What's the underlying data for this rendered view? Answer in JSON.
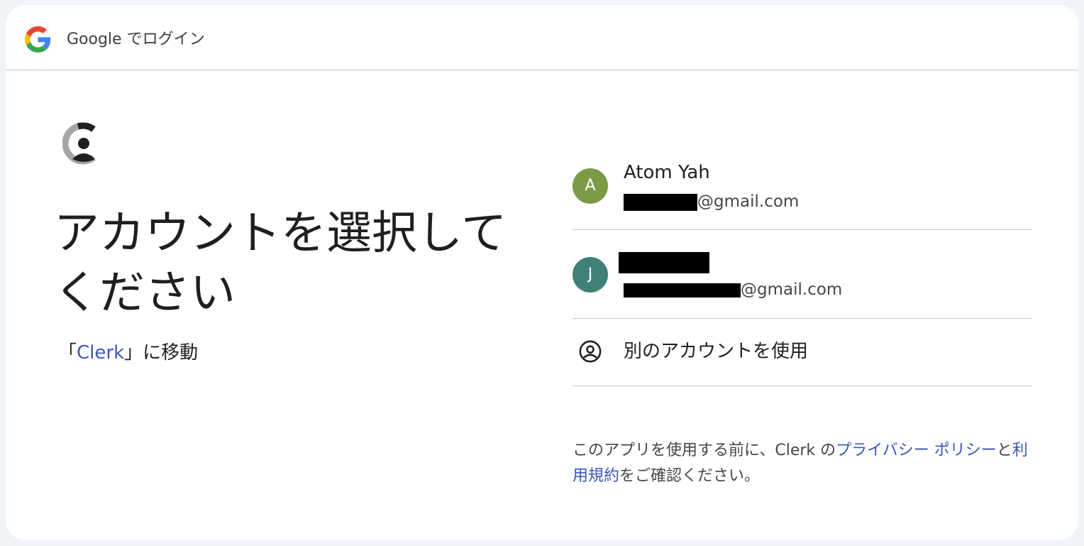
{
  "header": {
    "title": "Google でログイン",
    "logo_icon": "google-g-icon"
  },
  "app": {
    "logo_icon": "clerk-logo-icon"
  },
  "main": {
    "title": "アカウントを選択してください",
    "continue_prefix": "「",
    "continue_app": "Clerk",
    "continue_suffix": "」に移動"
  },
  "accounts": [
    {
      "initial": "A",
      "name": "Atom Yah",
      "email_visible": "@gmail.com",
      "avatar_color": "#7b9b46"
    },
    {
      "initial": "J",
      "name": "",
      "email_visible": "@gmail.com",
      "avatar_color": "#3f8079"
    }
  ],
  "other_account": {
    "label": "別のアカウントを使用",
    "icon": "account-circle-icon"
  },
  "footer": {
    "text_before": "このアプリを使用する前に、Clerk の",
    "privacy_link": "プライバシー ポリシー",
    "text_middle": "と",
    "terms_link": "利用規約",
    "text_after": "をご確認ください。"
  },
  "colors": {
    "link": "#3a57b9",
    "divider": "#c7c7c7",
    "text_primary": "#1f1f1f",
    "text_secondary": "#444746",
    "background": "#f0f4f9"
  }
}
